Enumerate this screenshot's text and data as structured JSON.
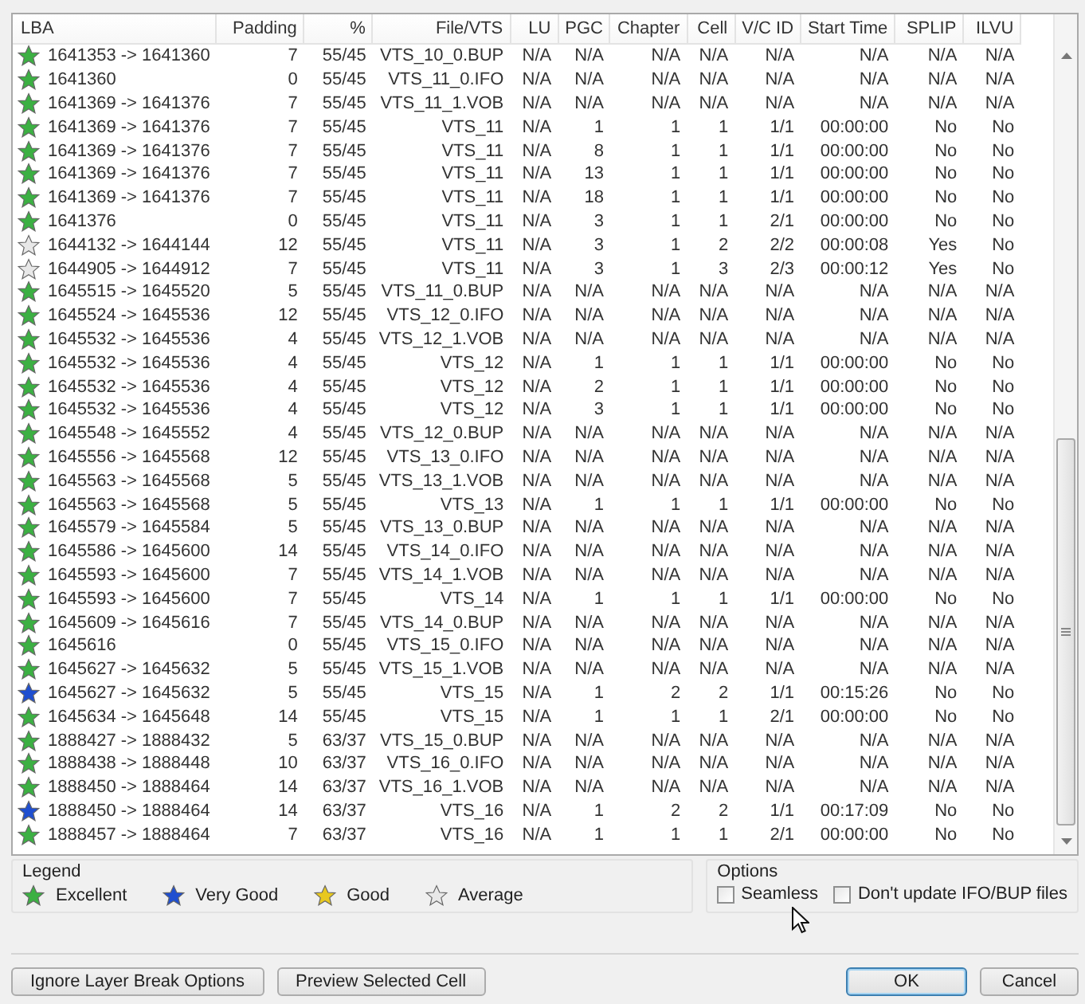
{
  "table": {
    "columns": [
      "LBA",
      "Padding",
      "%",
      "File/VTS",
      "LU",
      "PGC",
      "Chapter",
      "Cell",
      "V/C ID",
      "Start Time",
      "SPLIP",
      "ILVU"
    ],
    "rows": [
      {
        "color": "#3cb043",
        "cells": [
          "1641353 -> 1641360",
          "7",
          "55/45",
          "VTS_10_0.BUP",
          "N/A",
          "N/A",
          "N/A",
          "N/A",
          "N/A",
          "N/A",
          "N/A",
          "N/A"
        ]
      },
      {
        "color": "#3cb043",
        "cells": [
          "1641360",
          "0",
          "55/45",
          "VTS_11_0.IFO",
          "N/A",
          "N/A",
          "N/A",
          "N/A",
          "N/A",
          "N/A",
          "N/A",
          "N/A"
        ]
      },
      {
        "color": "#3cb043",
        "cells": [
          "1641369 -> 1641376",
          "7",
          "55/45",
          "VTS_11_1.VOB",
          "N/A",
          "N/A",
          "N/A",
          "N/A",
          "N/A",
          "N/A",
          "N/A",
          "N/A"
        ]
      },
      {
        "color": "#3cb043",
        "cells": [
          "1641369 -> 1641376",
          "7",
          "55/45",
          "VTS_11",
          "N/A",
          "1",
          "1",
          "1",
          "1/1",
          "00:00:00",
          "No",
          "No"
        ]
      },
      {
        "color": "#3cb043",
        "cells": [
          "1641369 -> 1641376",
          "7",
          "55/45",
          "VTS_11",
          "N/A",
          "8",
          "1",
          "1",
          "1/1",
          "00:00:00",
          "No",
          "No"
        ]
      },
      {
        "color": "#3cb043",
        "cells": [
          "1641369 -> 1641376",
          "7",
          "55/45",
          "VTS_11",
          "N/A",
          "13",
          "1",
          "1",
          "1/1",
          "00:00:00",
          "No",
          "No"
        ]
      },
      {
        "color": "#3cb043",
        "cells": [
          "1641369 -> 1641376",
          "7",
          "55/45",
          "VTS_11",
          "N/A",
          "18",
          "1",
          "1",
          "1/1",
          "00:00:00",
          "No",
          "No"
        ]
      },
      {
        "color": "#3cb043",
        "cells": [
          "1641376",
          "0",
          "55/45",
          "VTS_11",
          "N/A",
          "3",
          "1",
          "1",
          "2/1",
          "00:00:00",
          "No",
          "No"
        ]
      },
      {
        "color": "#e8e8e8",
        "cells": [
          "1644132 -> 1644144",
          "12",
          "55/45",
          "VTS_11",
          "N/A",
          "3",
          "1",
          "2",
          "2/2",
          "00:00:08",
          "Yes",
          "No"
        ]
      },
      {
        "color": "#e8e8e8",
        "cells": [
          "1644905 -> 1644912",
          "7",
          "55/45",
          "VTS_11",
          "N/A",
          "3",
          "1",
          "3",
          "2/3",
          "00:00:12",
          "Yes",
          "No"
        ]
      },
      {
        "color": "#3cb043",
        "cells": [
          "1645515 -> 1645520",
          "5",
          "55/45",
          "VTS_11_0.BUP",
          "N/A",
          "N/A",
          "N/A",
          "N/A",
          "N/A",
          "N/A",
          "N/A",
          "N/A"
        ]
      },
      {
        "color": "#3cb043",
        "cells": [
          "1645524 -> 1645536",
          "12",
          "55/45",
          "VTS_12_0.IFO",
          "N/A",
          "N/A",
          "N/A",
          "N/A",
          "N/A",
          "N/A",
          "N/A",
          "N/A"
        ]
      },
      {
        "color": "#3cb043",
        "cells": [
          "1645532 -> 1645536",
          "4",
          "55/45",
          "VTS_12_1.VOB",
          "N/A",
          "N/A",
          "N/A",
          "N/A",
          "N/A",
          "N/A",
          "N/A",
          "N/A"
        ]
      },
      {
        "color": "#3cb043",
        "cells": [
          "1645532 -> 1645536",
          "4",
          "55/45",
          "VTS_12",
          "N/A",
          "1",
          "1",
          "1",
          "1/1",
          "00:00:00",
          "No",
          "No"
        ]
      },
      {
        "color": "#3cb043",
        "cells": [
          "1645532 -> 1645536",
          "4",
          "55/45",
          "VTS_12",
          "N/A",
          "2",
          "1",
          "1",
          "1/1",
          "00:00:00",
          "No",
          "No"
        ]
      },
      {
        "color": "#3cb043",
        "cells": [
          "1645532 -> 1645536",
          "4",
          "55/45",
          "VTS_12",
          "N/A",
          "3",
          "1",
          "1",
          "1/1",
          "00:00:00",
          "No",
          "No"
        ]
      },
      {
        "color": "#3cb043",
        "cells": [
          "1645548 -> 1645552",
          "4",
          "55/45",
          "VTS_12_0.BUP",
          "N/A",
          "N/A",
          "N/A",
          "N/A",
          "N/A",
          "N/A",
          "N/A",
          "N/A"
        ]
      },
      {
        "color": "#3cb043",
        "cells": [
          "1645556 -> 1645568",
          "12",
          "55/45",
          "VTS_13_0.IFO",
          "N/A",
          "N/A",
          "N/A",
          "N/A",
          "N/A",
          "N/A",
          "N/A",
          "N/A"
        ]
      },
      {
        "color": "#3cb043",
        "cells": [
          "1645563 -> 1645568",
          "5",
          "55/45",
          "VTS_13_1.VOB",
          "N/A",
          "N/A",
          "N/A",
          "N/A",
          "N/A",
          "N/A",
          "N/A",
          "N/A"
        ]
      },
      {
        "color": "#3cb043",
        "cells": [
          "1645563 -> 1645568",
          "5",
          "55/45",
          "VTS_13",
          "N/A",
          "1",
          "1",
          "1",
          "1/1",
          "00:00:00",
          "No",
          "No"
        ]
      },
      {
        "color": "#3cb043",
        "cells": [
          "1645579 -> 1645584",
          "5",
          "55/45",
          "VTS_13_0.BUP",
          "N/A",
          "N/A",
          "N/A",
          "N/A",
          "N/A",
          "N/A",
          "N/A",
          "N/A"
        ]
      },
      {
        "color": "#3cb043",
        "cells": [
          "1645586 -> 1645600",
          "14",
          "55/45",
          "VTS_14_0.IFO",
          "N/A",
          "N/A",
          "N/A",
          "N/A",
          "N/A",
          "N/A",
          "N/A",
          "N/A"
        ]
      },
      {
        "color": "#3cb043",
        "cells": [
          "1645593 -> 1645600",
          "7",
          "55/45",
          "VTS_14_1.VOB",
          "N/A",
          "N/A",
          "N/A",
          "N/A",
          "N/A",
          "N/A",
          "N/A",
          "N/A"
        ]
      },
      {
        "color": "#3cb043",
        "cells": [
          "1645593 -> 1645600",
          "7",
          "55/45",
          "VTS_14",
          "N/A",
          "1",
          "1",
          "1",
          "1/1",
          "00:00:00",
          "No",
          "No"
        ]
      },
      {
        "color": "#3cb043",
        "cells": [
          "1645609 -> 1645616",
          "7",
          "55/45",
          "VTS_14_0.BUP",
          "N/A",
          "N/A",
          "N/A",
          "N/A",
          "N/A",
          "N/A",
          "N/A",
          "N/A"
        ]
      },
      {
        "color": "#3cb043",
        "cells": [
          "1645616",
          "0",
          "55/45",
          "VTS_15_0.IFO",
          "N/A",
          "N/A",
          "N/A",
          "N/A",
          "N/A",
          "N/A",
          "N/A",
          "N/A"
        ]
      },
      {
        "color": "#3cb043",
        "cells": [
          "1645627 -> 1645632",
          "5",
          "55/45",
          "VTS_15_1.VOB",
          "N/A",
          "N/A",
          "N/A",
          "N/A",
          "N/A",
          "N/A",
          "N/A",
          "N/A"
        ]
      },
      {
        "color": "#1f4fd0",
        "cells": [
          "1645627 -> 1645632",
          "5",
          "55/45",
          "VTS_15",
          "N/A",
          "1",
          "2",
          "2",
          "1/1",
          "00:15:26",
          "No",
          "No"
        ]
      },
      {
        "color": "#3cb043",
        "cells": [
          "1645634 -> 1645648",
          "14",
          "55/45",
          "VTS_15",
          "N/A",
          "1",
          "1",
          "1",
          "2/1",
          "00:00:00",
          "No",
          "No"
        ]
      },
      {
        "color": "#3cb043",
        "cells": [
          "1888427 -> 1888432",
          "5",
          "63/37",
          "VTS_15_0.BUP",
          "N/A",
          "N/A",
          "N/A",
          "N/A",
          "N/A",
          "N/A",
          "N/A",
          "N/A"
        ]
      },
      {
        "color": "#3cb043",
        "cells": [
          "1888438 -> 1888448",
          "10",
          "63/37",
          "VTS_16_0.IFO",
          "N/A",
          "N/A",
          "N/A",
          "N/A",
          "N/A",
          "N/A",
          "N/A",
          "N/A"
        ]
      },
      {
        "color": "#3cb043",
        "cells": [
          "1888450 -> 1888464",
          "14",
          "63/37",
          "VTS_16_1.VOB",
          "N/A",
          "N/A",
          "N/A",
          "N/A",
          "N/A",
          "N/A",
          "N/A",
          "N/A"
        ]
      },
      {
        "color": "#1f4fd0",
        "cells": [
          "1888450 -> 1888464",
          "14",
          "63/37",
          "VTS_16",
          "N/A",
          "1",
          "2",
          "2",
          "1/1",
          "00:17:09",
          "No",
          "No"
        ]
      },
      {
        "color": "#3cb043",
        "cells": [
          "1888457 -> 1888464",
          "7",
          "63/37",
          "VTS_16",
          "N/A",
          "1",
          "1",
          "1",
          "2/1",
          "00:00:00",
          "No",
          "No"
        ]
      }
    ]
  },
  "legend": {
    "title": "Legend",
    "items": [
      {
        "label": "Excellent",
        "color": "#3cb043"
      },
      {
        "label": "Very Good",
        "color": "#1f4fd0"
      },
      {
        "label": "Good",
        "color": "#e8c81e"
      },
      {
        "label": "Average",
        "color": "#e8e8e8"
      }
    ]
  },
  "options": {
    "title": "Options",
    "items": [
      {
        "label": "Seamless",
        "checked": false
      },
      {
        "label": "Don't update IFO/BUP files",
        "checked": false
      }
    ]
  },
  "buttons_left": [
    "Ignore Layer Break Options",
    "Preview Selected Cell"
  ],
  "buttons_right": [
    {
      "label": "OK",
      "selected": true
    },
    {
      "label": "Cancel",
      "selected": false
    }
  ]
}
